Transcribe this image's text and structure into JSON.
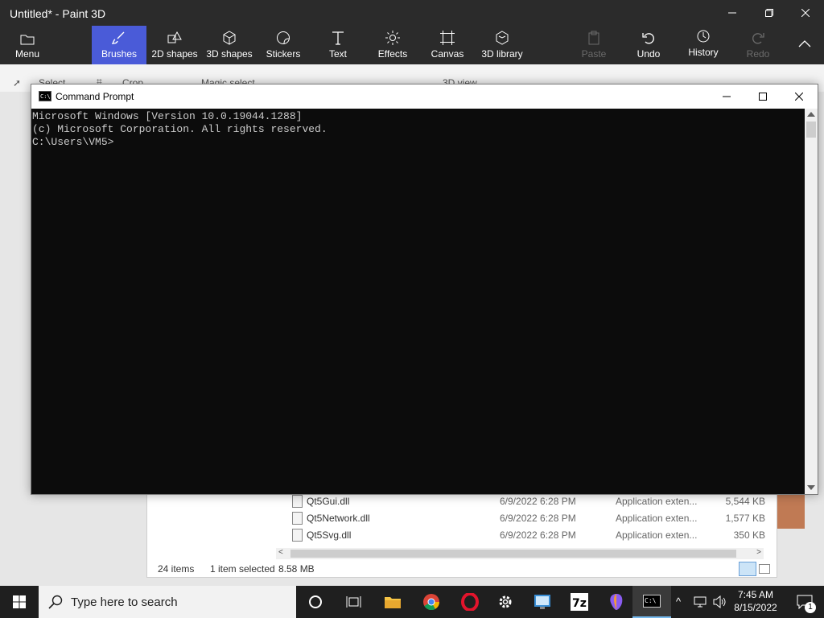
{
  "paint": {
    "title": "Untitled* - Paint 3D",
    "ribbon": [
      {
        "label": "Menu",
        "icon": "folder-icon"
      },
      {
        "label": "Brushes",
        "icon": "brush-icon",
        "active": true
      },
      {
        "label": "2D shapes",
        "icon": "2d-shapes-icon"
      },
      {
        "label": "3D shapes",
        "icon": "cube-icon"
      },
      {
        "label": "Stickers",
        "icon": "sticker-icon"
      },
      {
        "label": "Text",
        "icon": "text-icon"
      },
      {
        "label": "Effects",
        "icon": "sun-icon"
      },
      {
        "label": "Canvas",
        "icon": "canvas-icon"
      },
      {
        "label": "3D library",
        "icon": "library-icon"
      },
      {
        "label": "Paste",
        "icon": "paste-icon",
        "disabled": true
      },
      {
        "label": "Undo",
        "icon": "undo-icon"
      },
      {
        "label": "History",
        "icon": "history-icon"
      },
      {
        "label": "Redo",
        "icon": "redo-icon",
        "disabled": true
      }
    ],
    "subbar": {
      "select": "Select",
      "crop": "Crop",
      "magic_select": "Magic select",
      "view_3d": "3D view"
    }
  },
  "explorer": {
    "files": [
      {
        "name": "Qt5Gui.dll",
        "date": "6/9/2022 6:28 PM",
        "type": "Application exten...",
        "size": "5,544 KB"
      },
      {
        "name": "Qt5Network.dll",
        "date": "6/9/2022 6:28 PM",
        "type": "Application exten...",
        "size": "1,577 KB"
      },
      {
        "name": "Qt5Svg.dll",
        "date": "6/9/2022 6:28 PM",
        "type": "Application exten...",
        "size": "350 KB"
      }
    ],
    "status_items": "24 items",
    "status_selected": "1 item selected",
    "status_size": "8.58 MB"
  },
  "cmd": {
    "title": "Command Prompt",
    "lines": [
      "Microsoft Windows [Version 10.0.19044.1288]",
      "(c) Microsoft Corporation. All rights reserved.",
      "",
      "C:\\Users\\VM5>"
    ]
  },
  "taskbar": {
    "search_placeholder": "Type here to search",
    "time": "7:45 AM",
    "date": "8/15/2022",
    "notification_count": "1"
  }
}
